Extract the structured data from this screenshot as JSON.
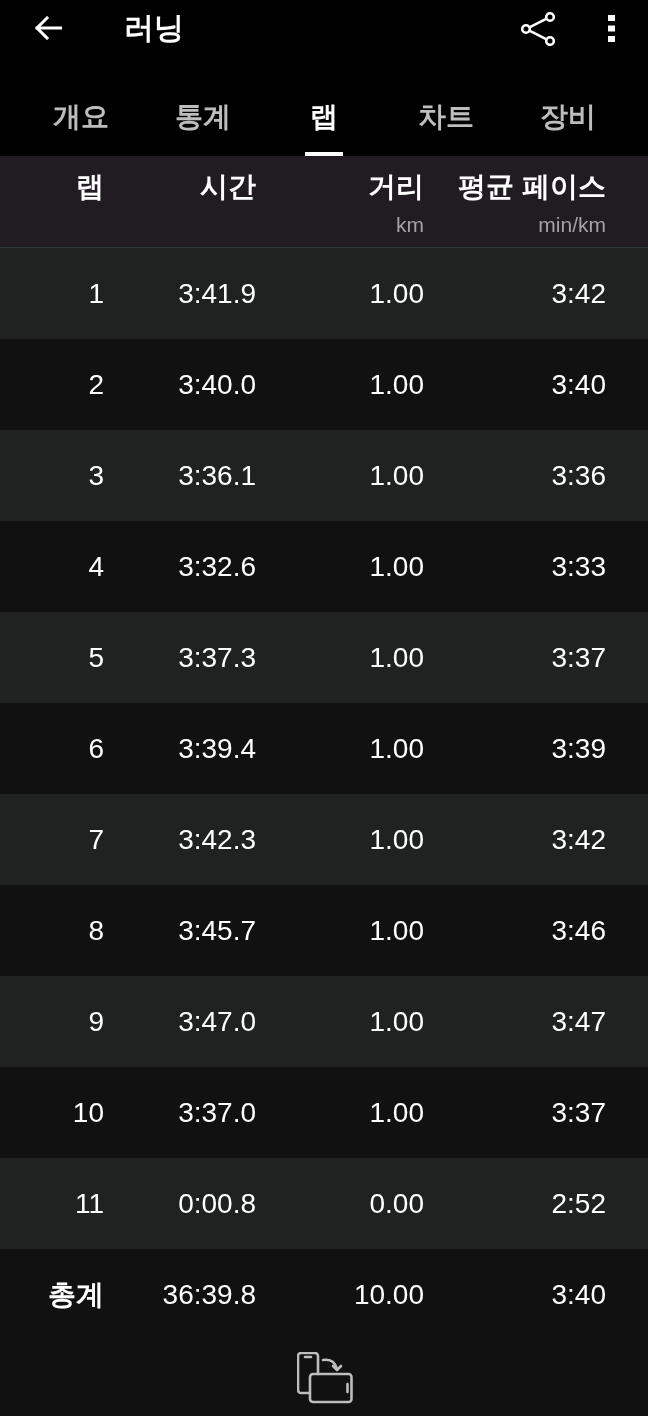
{
  "top_bar": {
    "title": "러닝"
  },
  "tabs": [
    {
      "label": "개요",
      "selected": false
    },
    {
      "label": "통계",
      "selected": false
    },
    {
      "label": "랩",
      "selected": true
    },
    {
      "label": "차트",
      "selected": false
    },
    {
      "label": "장비",
      "selected": false
    }
  ],
  "table": {
    "columns": [
      {
        "label": "랩"
      },
      {
        "label": "시간"
      },
      {
        "label": "거리",
        "unit": "km"
      },
      {
        "label": "평균 페이스",
        "unit": "min/km"
      }
    ],
    "rows": [
      [
        "1",
        "3:41.9",
        "1.00",
        "3:42"
      ],
      [
        "2",
        "3:40.0",
        "1.00",
        "3:40"
      ],
      [
        "3",
        "3:36.1",
        "1.00",
        "3:36"
      ],
      [
        "4",
        "3:32.6",
        "1.00",
        "3:33"
      ],
      [
        "5",
        "3:37.3",
        "1.00",
        "3:37"
      ],
      [
        "6",
        "3:39.4",
        "1.00",
        "3:39"
      ],
      [
        "7",
        "3:42.3",
        "1.00",
        "3:42"
      ],
      [
        "8",
        "3:45.7",
        "1.00",
        "3:46"
      ],
      [
        "9",
        "3:47.0",
        "1.00",
        "3:47"
      ],
      [
        "10",
        "3:37.0",
        "1.00",
        "3:37"
      ],
      [
        "11",
        "0:00.8",
        "0.00",
        "2:52"
      ]
    ],
    "total": [
      "총계",
      "36:39.8",
      "10.00",
      "3:40"
    ]
  }
}
